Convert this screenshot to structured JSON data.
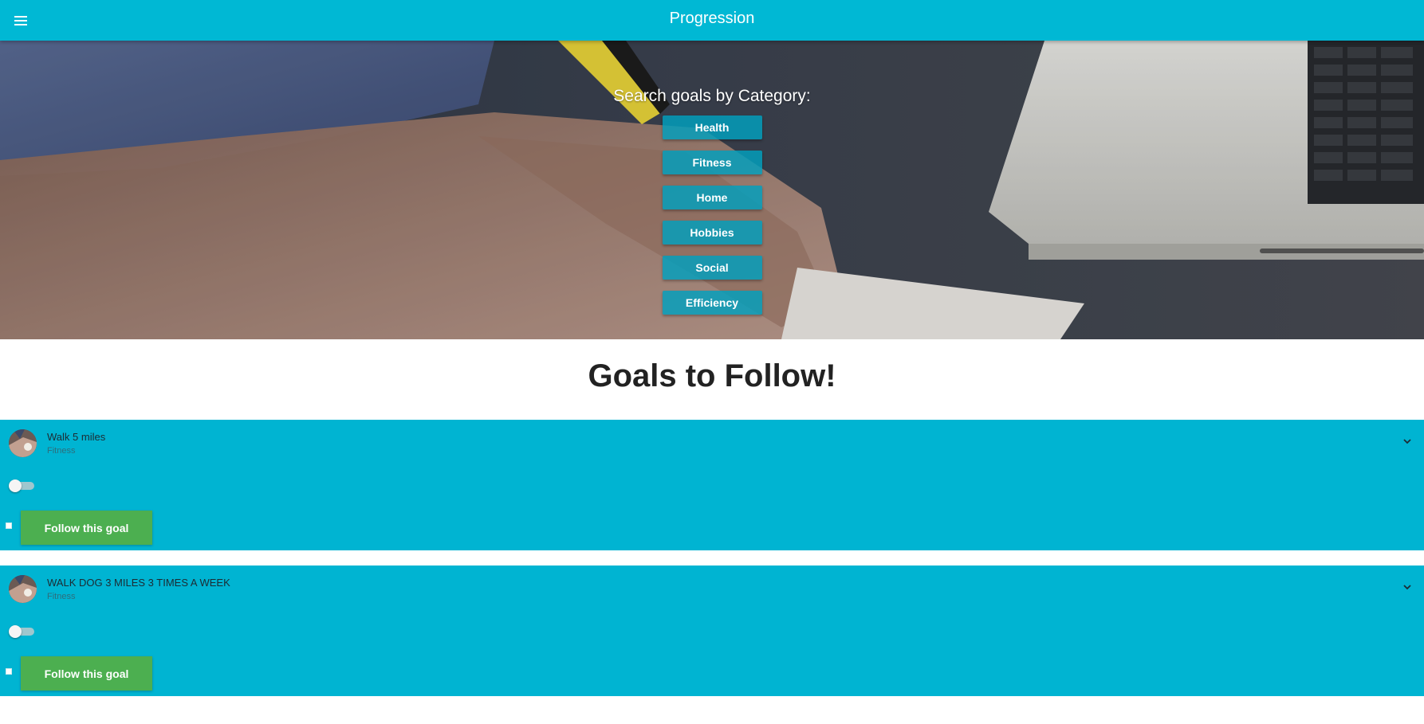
{
  "app": {
    "title": "Progression"
  },
  "hero": {
    "heading": "Search goals by Category:",
    "categories": [
      "Health",
      "Fitness",
      "Home",
      "Hobbies",
      "Social",
      "Efficiency"
    ]
  },
  "goals_section": {
    "title": "Goals to Follow!",
    "follow_label": "Follow this goal",
    "goals": [
      {
        "name": "Walk 5 miles",
        "category": "Fitness",
        "toggle_on": false
      },
      {
        "name": "WALK DOG 3 MILES 3 TIMES A WEEK",
        "category": "Fitness",
        "toggle_on": false
      }
    ]
  },
  "colors": {
    "primary": "#00b8d4",
    "card": "#00b4d2",
    "follow_button": "#4caf50",
    "category_button": "#1a9fb8"
  },
  "icons": {
    "menu": "hamburger-menu-icon",
    "expand": "chevron-down-icon"
  }
}
